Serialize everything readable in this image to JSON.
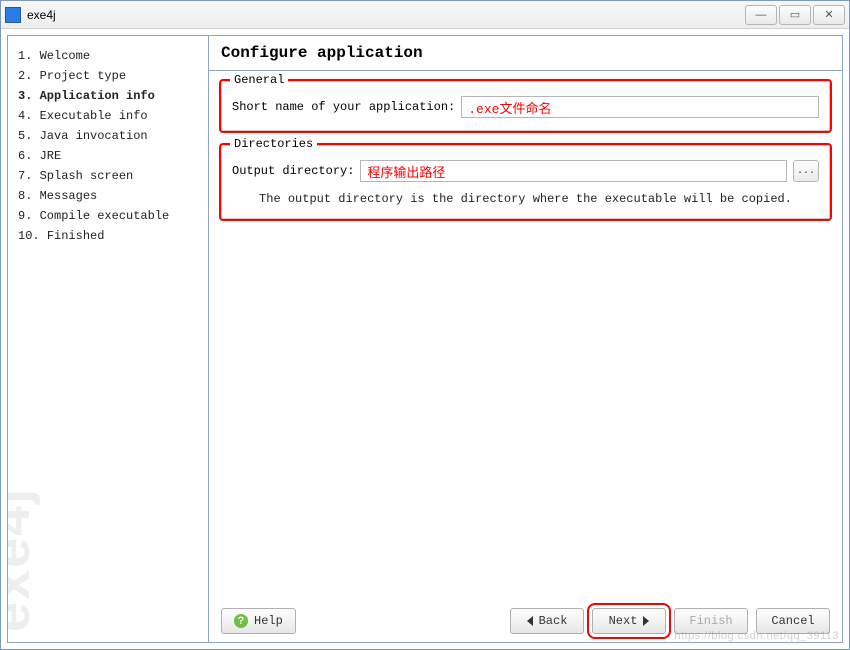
{
  "window": {
    "title": "exe4j",
    "watermark": "exe4j"
  },
  "sidebar": {
    "items": [
      {
        "num": "1.",
        "label": "Welcome"
      },
      {
        "num": "2.",
        "label": "Project type"
      },
      {
        "num": "3.",
        "label": "Application info",
        "current": true
      },
      {
        "num": "4.",
        "label": "Executable info"
      },
      {
        "num": "5.",
        "label": "Java invocation"
      },
      {
        "num": "6.",
        "label": "JRE"
      },
      {
        "num": "7.",
        "label": "Splash screen"
      },
      {
        "num": "8.",
        "label": "Messages"
      },
      {
        "num": "9.",
        "label": "Compile executable"
      },
      {
        "num": "10.",
        "label": "Finished"
      }
    ]
  },
  "main": {
    "heading": "Configure application",
    "general": {
      "legend": "General",
      "short_name_label": "Short name of your application:",
      "short_name_value": ".exe文件命名"
    },
    "directories": {
      "legend": "Directories",
      "output_label": "Output directory:",
      "output_value": "程序输出路径",
      "browse_text": "...",
      "hint": "The output directory is the directory where the executable will be copied."
    }
  },
  "footer": {
    "help": "Help",
    "back": "Back",
    "next": "Next",
    "finish": "Finish",
    "cancel": "Cancel"
  },
  "overlay_watermark": "https://blog.csdn.net/qq_39113"
}
